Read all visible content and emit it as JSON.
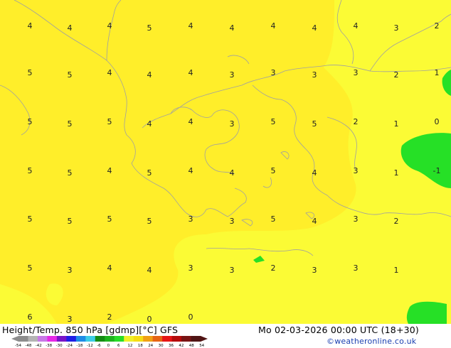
{
  "title": "Height/Temp. 850 hPa [gdmp][°C] GFS",
  "datetime": "Mo 02-03-2026 00:00 UTC (18+30)",
  "credit": "©weatheronline.co.uk",
  "colorbar": {
    "ticks": [
      "-54",
      "-48",
      "-42",
      "-38",
      "-30",
      "-24",
      "-18",
      "-12",
      "-6",
      "0",
      "6",
      "12",
      "18",
      "24",
      "30",
      "36",
      "42",
      "48",
      "54"
    ],
    "colors": [
      "#8c8c8c",
      "#b4b4b4",
      "#c878e6",
      "#e628e6",
      "#7814c8",
      "#1e1ee6",
      "#1e8ce6",
      "#3ccde6",
      "#148c14",
      "#1eb41e",
      "#28dc28",
      "#f0f028",
      "#f5dc14",
      "#f0a014",
      "#e66414",
      "#e61414",
      "#b40a0a",
      "#781414",
      "#501414"
    ]
  },
  "colors": {
    "warm_yellow": "#ffee2a",
    "light_yellow": "#fbfb35",
    "green": "#26e026",
    "coast": "#a0a0a0"
  },
  "values": [
    {
      "v": "4",
      "r": 1,
      "c": 1
    },
    {
      "v": "4",
      "r": 1,
      "c": 2
    },
    {
      "v": "4",
      "r": 1,
      "c": 3
    },
    {
      "v": "5",
      "r": 1,
      "c": 4
    },
    {
      "v": "4",
      "r": 1,
      "c": 5
    },
    {
      "v": "4",
      "r": 1,
      "c": 6
    },
    {
      "v": "4",
      "r": 1,
      "c": 7
    },
    {
      "v": "4",
      "r": 1,
      "c": 8
    },
    {
      "v": "4",
      "r": 1,
      "c": 9
    },
    {
      "v": "3",
      "r": 1,
      "c": 10
    },
    {
      "v": "2",
      "r": 1,
      "c": 11
    },
    {
      "v": "5",
      "r": 2,
      "c": 1
    },
    {
      "v": "5",
      "r": 2,
      "c": 2
    },
    {
      "v": "4",
      "r": 2,
      "c": 3
    },
    {
      "v": "4",
      "r": 2,
      "c": 4
    },
    {
      "v": "4",
      "r": 2,
      "c": 5
    },
    {
      "v": "3",
      "r": 2,
      "c": 6
    },
    {
      "v": "3",
      "r": 2,
      "c": 7
    },
    {
      "v": "3",
      "r": 2,
      "c": 8
    },
    {
      "v": "3",
      "r": 2,
      "c": 9
    },
    {
      "v": "2",
      "r": 2,
      "c": 10
    },
    {
      "v": "1",
      "r": 2,
      "c": 11
    },
    {
      "v": "5",
      "r": 3,
      "c": 1
    },
    {
      "v": "5",
      "r": 3,
      "c": 2
    },
    {
      "v": "5",
      "r": 3,
      "c": 3
    },
    {
      "v": "4",
      "r": 3,
      "c": 4
    },
    {
      "v": "4",
      "r": 3,
      "c": 5
    },
    {
      "v": "3",
      "r": 3,
      "c": 6
    },
    {
      "v": "5",
      "r": 3,
      "c": 7
    },
    {
      "v": "5",
      "r": 3,
      "c": 8
    },
    {
      "v": "2",
      "r": 3,
      "c": 9
    },
    {
      "v": "1",
      "r": 3,
      "c": 10
    },
    {
      "v": "0",
      "r": 3,
      "c": 11
    },
    {
      "v": "5",
      "r": 4,
      "c": 1
    },
    {
      "v": "5",
      "r": 4,
      "c": 2
    },
    {
      "v": "4",
      "r": 4,
      "c": 3
    },
    {
      "v": "5",
      "r": 4,
      "c": 4
    },
    {
      "v": "4",
      "r": 4,
      "c": 5
    },
    {
      "v": "4",
      "r": 4,
      "c": 6
    },
    {
      "v": "5",
      "r": 4,
      "c": 7
    },
    {
      "v": "4",
      "r": 4,
      "c": 8
    },
    {
      "v": "3",
      "r": 4,
      "c": 9
    },
    {
      "v": "1",
      "r": 4,
      "c": 10
    },
    {
      "v": "-1",
      "r": 4,
      "c": 11
    },
    {
      "v": "5",
      "r": 5,
      "c": 1
    },
    {
      "v": "5",
      "r": 5,
      "c": 2
    },
    {
      "v": "5",
      "r": 5,
      "c": 3
    },
    {
      "v": "5",
      "r": 5,
      "c": 4
    },
    {
      "v": "3",
      "r": 5,
      "c": 5
    },
    {
      "v": "3",
      "r": 5,
      "c": 6
    },
    {
      "v": "5",
      "r": 5,
      "c": 7
    },
    {
      "v": "4",
      "r": 5,
      "c": 8
    },
    {
      "v": "3",
      "r": 5,
      "c": 9
    },
    {
      "v": "2",
      "r": 5,
      "c": 10
    },
    {
      "v": "5",
      "r": 6,
      "c": 1
    },
    {
      "v": "3",
      "r": 6,
      "c": 2
    },
    {
      "v": "4",
      "r": 6,
      "c": 3
    },
    {
      "v": "4",
      "r": 6,
      "c": 4
    },
    {
      "v": "3",
      "r": 6,
      "c": 5
    },
    {
      "v": "3",
      "r": 6,
      "c": 6
    },
    {
      "v": "2",
      "r": 6,
      "c": 7
    },
    {
      "v": "3",
      "r": 6,
      "c": 8
    },
    {
      "v": "3",
      "r": 6,
      "c": 9
    },
    {
      "v": "1",
      "r": 6,
      "c": 10
    },
    {
      "v": "6",
      "r": 7,
      "c": 1
    },
    {
      "v": "3",
      "r": 7,
      "c": 2
    },
    {
      "v": "2",
      "r": 7,
      "c": 3
    },
    {
      "v": "0",
      "r": 7,
      "c": 4
    },
    {
      "v": "0",
      "r": 7,
      "c": 5
    }
  ]
}
